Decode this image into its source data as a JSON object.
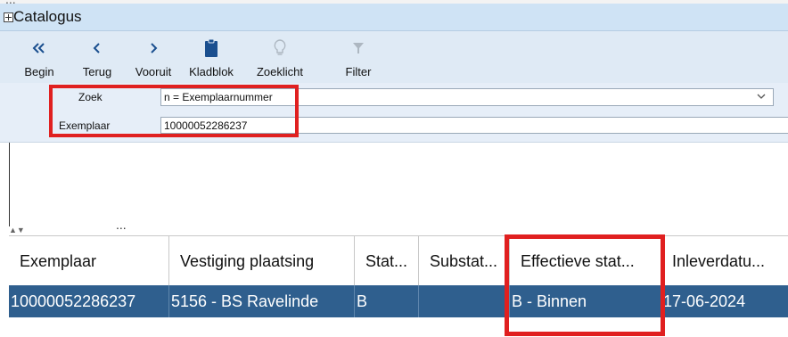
{
  "window": {
    "title": "Catalogus"
  },
  "toolbar": {
    "begin": "Begin",
    "terug": "Terug",
    "vooruit": "Vooruit",
    "kladblok": "Kladblok",
    "zoeklicht": "Zoeklicht",
    "filter": "Filter"
  },
  "search": {
    "zoek_label": "Zoek",
    "zoek_value": "n = Exemplaarnummer",
    "exemplaar_label": "Exemplaar",
    "exemplaar_value": "10000052286237"
  },
  "table": {
    "columns": [
      "Exemplaar",
      "Vestiging plaatsing",
      "Stat...",
      "Substat...",
      "Effectieve stat...",
      "Inleverdatu..."
    ],
    "rows": [
      [
        "10000052286237",
        "5156 - BS Ravelinde",
        "B",
        "",
        "B - Binnen",
        "17-06-2024"
      ]
    ]
  },
  "colors": {
    "accent_red": "#e02020",
    "selected_row": "#2f5f8e",
    "toolbar_bg": "#dfeaf5"
  }
}
